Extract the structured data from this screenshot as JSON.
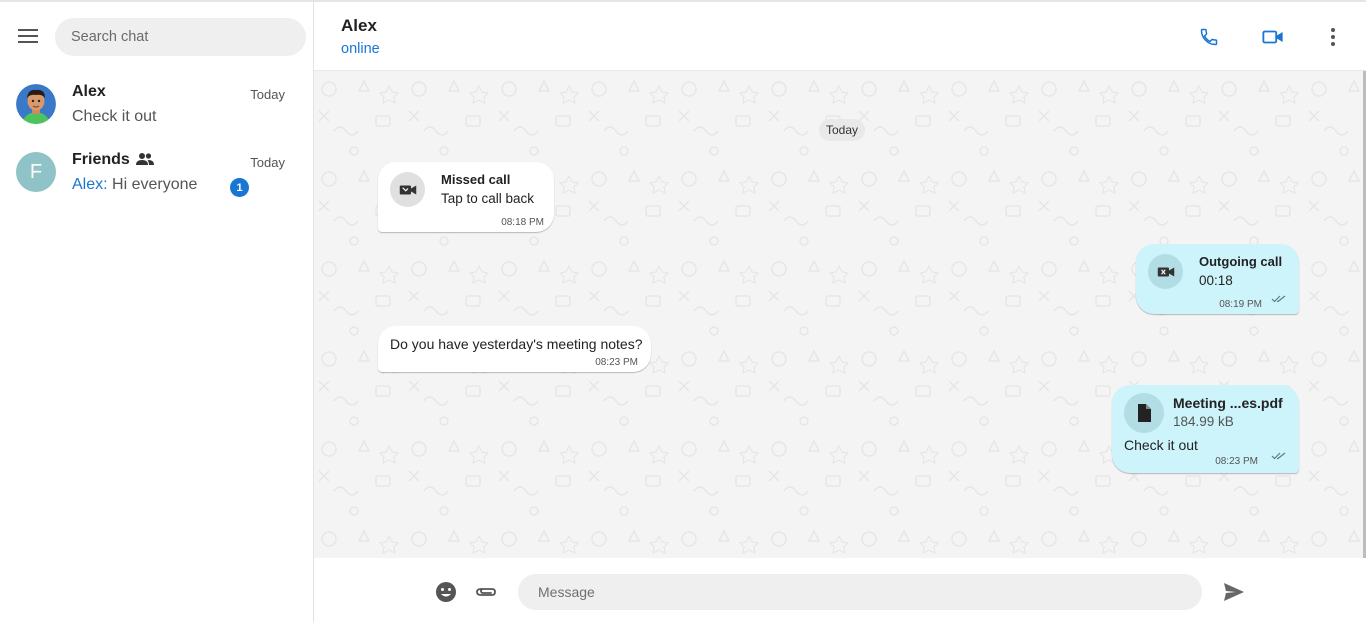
{
  "sidebar": {
    "search_placeholder": "Search chat",
    "chats": [
      {
        "name": "Alex",
        "time": "Today",
        "preview": "Check it out",
        "avatar_icon": "alex-avatar"
      },
      {
        "name": "Friends",
        "time": "Today",
        "preview_sender": "Alex:",
        "preview": " Hi everyone",
        "avatar_letter": "F",
        "badge": "1",
        "group_icon": "group-icon"
      }
    ]
  },
  "header": {
    "name": "Alex",
    "status": "online",
    "icons": [
      "phone-icon",
      "video-icon",
      "more-vert-icon"
    ]
  },
  "messages": {
    "date": "Today",
    "items": [
      {
        "direction": "in",
        "type": "call",
        "title": "Missed call",
        "subtitle": "Tap to call back",
        "time": "08:18 PM",
        "icon": "missed-video-call-icon"
      },
      {
        "direction": "out",
        "type": "call",
        "title": "Outgoing call",
        "subtitle": "00:18",
        "time": "08:19 PM",
        "icon": "video-call-icon",
        "status_icon": "double-check-icon"
      },
      {
        "direction": "in",
        "type": "text",
        "text": "Do you have yesterday's meeting notes?",
        "time": "08:23 PM"
      },
      {
        "direction": "out",
        "type": "file",
        "filename": "Meeting ...es.pdf",
        "filesize": "184.99 kB",
        "caption": "Check it out",
        "time": "08:23 PM",
        "icon": "file-icon",
        "status_icon": "double-check-icon"
      }
    ]
  },
  "composer": {
    "placeholder": "Message",
    "icons": [
      "emoji-icon",
      "attach-icon",
      "send-icon"
    ]
  },
  "colors": {
    "accent": "#1976d2",
    "outgoing_bubble": "#cdf4fb",
    "incoming_bubble": "#ffffff",
    "chat_background": "#f4f4f4"
  }
}
